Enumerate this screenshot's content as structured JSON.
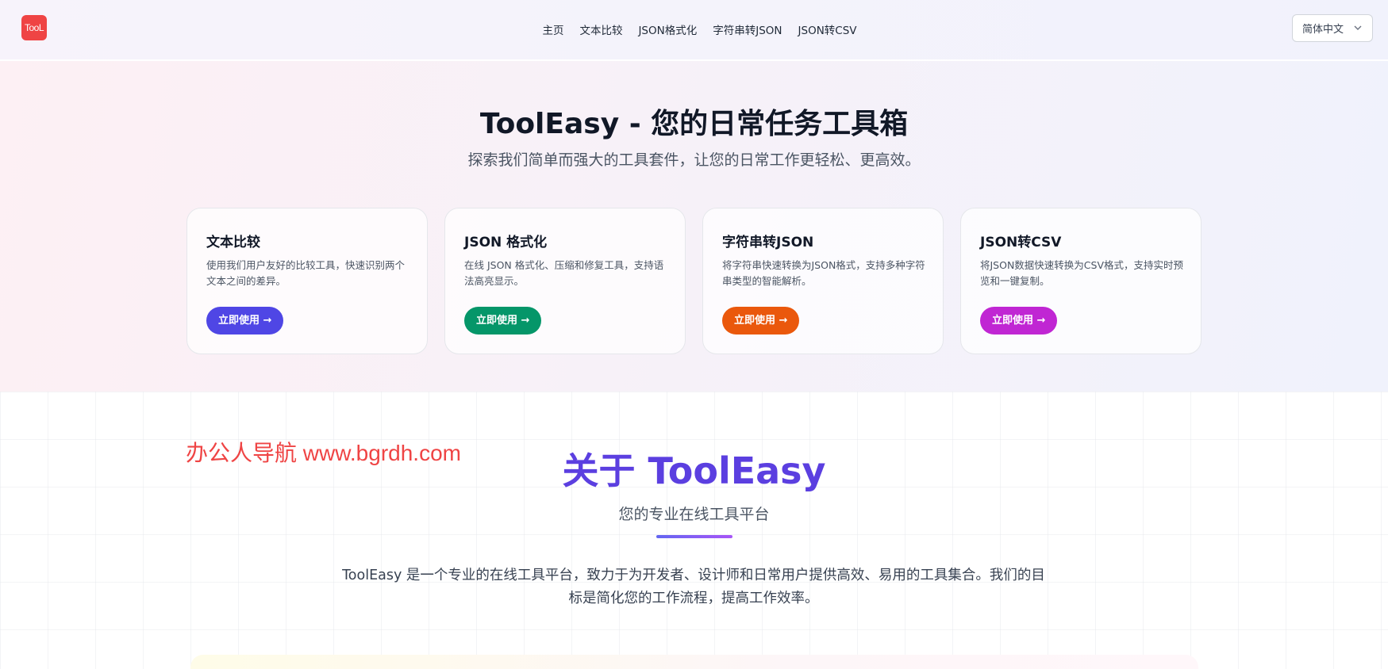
{
  "header": {
    "logo_text": "TooL",
    "nav": [
      "主页",
      "文本比较",
      "JSON格式化",
      "字符串转JSON",
      "JSON转CSV"
    ],
    "language": "简体中文"
  },
  "hero": {
    "title": "ToolEasy - 您的日常任务工具箱",
    "subtitle": "探索我们简单而强大的工具套件，让您的日常工作更轻松、更高效。",
    "cards": [
      {
        "title": "文本比较",
        "description": "使用我们用户友好的比较工具，快速识别两个文本之间的差异。",
        "button": "立即使用 →",
        "color": "#4f46e5"
      },
      {
        "title": "JSON 格式化",
        "description": "在线 JSON 格式化、压缩和修复工具，支持语法高亮显示。",
        "button": "立即使用 →",
        "color": "#059669"
      },
      {
        "title": "字符串转JSON",
        "description": "将字符串快速转换为JSON格式，支持多种字符串类型的智能解析。",
        "button": "立即使用 →",
        "color": "#ea580c"
      },
      {
        "title": "JSON转CSV",
        "description": "将JSON数据快速转换为CSV格式，支持实时预览和一键复制。",
        "button": "立即使用 →",
        "color": "#c026d3"
      }
    ]
  },
  "about": {
    "watermark": "办公人导航  www.bgrdh.com",
    "title": "关于 ToolEasy",
    "subtitle": "您的专业在线工具平台",
    "text": "ToolEasy 是一个专业的在线工具平台，致力于为开发者、设计师和日常用户提供高效、易用的工具集合。我们的目标是简化您的工作流程，提高工作效率。"
  }
}
